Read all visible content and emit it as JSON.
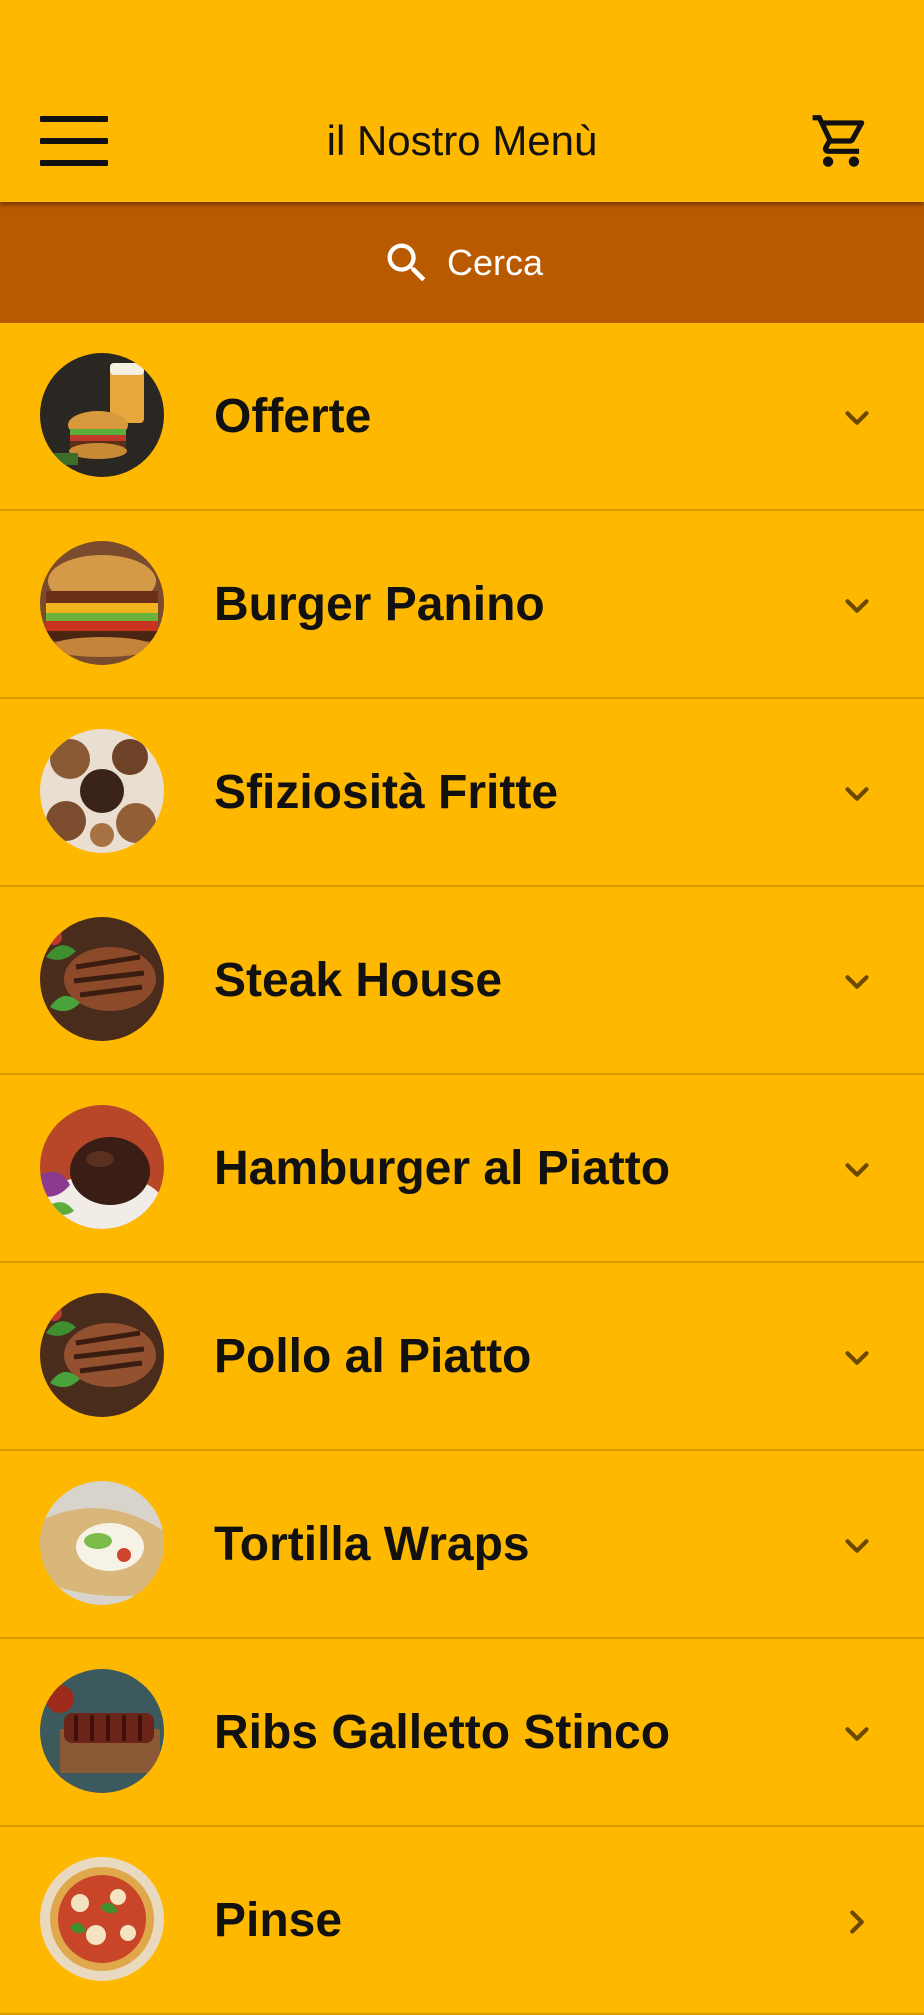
{
  "app_bar": {
    "title": "il Nostro Menù",
    "menu_icon": "hamburger-menu-icon",
    "cart_icon": "shopping-cart-icon"
  },
  "search": {
    "label": "Cerca",
    "icon": "search-icon"
  },
  "colors": {
    "background": "#FFB800",
    "search_bar": "#B95A00",
    "text": "#111111",
    "chevron": "#6B4A00"
  },
  "categories": [
    {
      "label": "Offerte",
      "image": "burger-with-beer-thumbnail",
      "indicator": "chevron-down-icon"
    },
    {
      "label": "Burger Panino",
      "image": "bacon-cheeseburger-thumbnail",
      "indicator": "chevron-down-icon"
    },
    {
      "label": "Sfiziosità Fritte",
      "image": "fried-snacks-thumbnail",
      "indicator": "chevron-down-icon"
    },
    {
      "label": "Steak House",
      "image": "grilled-steak-thumbnail",
      "indicator": "chevron-down-icon"
    },
    {
      "label": "Hamburger al Piatto",
      "image": "hamburger-patty-plate-thumbnail",
      "indicator": "chevron-down-icon"
    },
    {
      "label": "Pollo al Piatto",
      "image": "grilled-meat-plate-thumbnail",
      "indicator": "chevron-down-icon"
    },
    {
      "label": "Tortilla Wraps",
      "image": "tortilla-wrap-thumbnail",
      "indicator": "chevron-down-icon"
    },
    {
      "label": "Ribs Galletto Stinco",
      "image": "bbq-ribs-thumbnail",
      "indicator": "chevron-down-icon"
    },
    {
      "label": "Pinse",
      "image": "pizza-thumbnail",
      "indicator": "chevron-right-icon"
    }
  ]
}
